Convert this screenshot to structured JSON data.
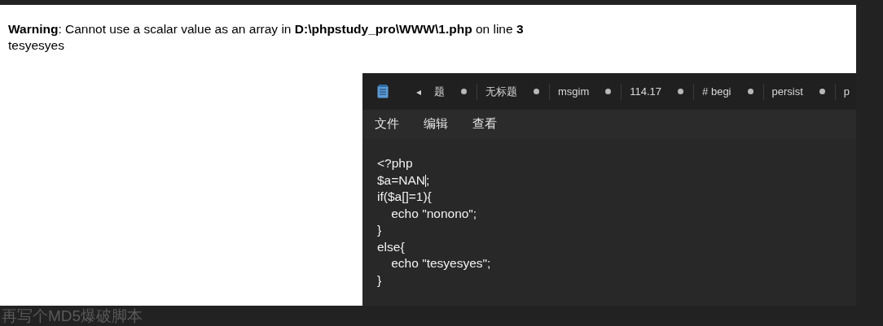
{
  "browser_page": {
    "warning": "**Warning**: Cannot use a scalar value as an array in **D:\\phpstudy_pro\\WWW\\1.php** on line **3**",
    "output": "tesyesyes"
  },
  "notepad": {
    "scroll_left": "◂",
    "tabs": [
      {
        "label": "题",
        "unsaved": true
      },
      {
        "label": "无标题",
        "unsaved": true
      },
      {
        "label": "msgim",
        "unsaved": true
      },
      {
        "label": "114.17",
        "unsaved": true
      },
      {
        "label": "# begi",
        "unsaved": true
      },
      {
        "label": "persist",
        "unsaved": true
      },
      {
        "label": "p",
        "unsaved": false
      }
    ],
    "menu": [
      "文件",
      "编辑",
      "查看"
    ],
    "lines": [
      {
        "parts": [
          "<?php"
        ]
      },
      {
        "parts": [
          "$a=NAN",
          ";"
        ]
      },
      {
        "parts": [
          "if($a[]=1){"
        ]
      },
      {
        "parts": [
          "    echo \"nonono\";"
        ]
      },
      {
        "parts": [
          "}"
        ]
      },
      {
        "parts": [
          "else{"
        ]
      },
      {
        "parts": [
          "    echo \"tesyesyes\";"
        ]
      },
      {
        "parts": [
          "}"
        ]
      }
    ]
  },
  "heading": "再写个MD5爆破脚本"
}
